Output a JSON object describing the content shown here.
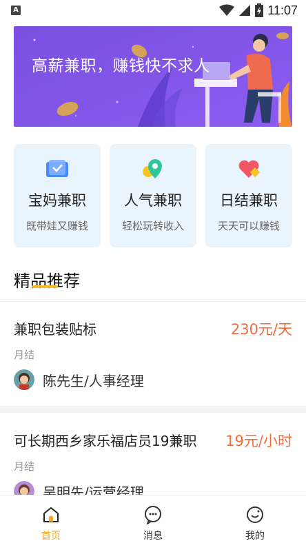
{
  "status_bar": {
    "left_badge": "A",
    "time": "11:07",
    "icons": [
      "wifi-icon",
      "signal-icon",
      "battery-icon"
    ]
  },
  "banner": {
    "title": "高薪兼职，赚钱快不求人"
  },
  "categories": [
    {
      "title": "宝妈兼职",
      "subtitle": "既带娃又赚钱",
      "icon": "card-icon"
    },
    {
      "title": "人气兼职",
      "subtitle": "轻松玩转收入",
      "icon": "location-icon"
    },
    {
      "title": "日结兼职",
      "subtitle": "天天可以赚钱",
      "icon": "heart-icon"
    }
  ],
  "section": {
    "title": "精品推荐"
  },
  "jobs": [
    {
      "title": "兼职包装贴标",
      "salary": "230元/天",
      "pay_cycle": "月结",
      "poster": "陈先生/人事经理"
    },
    {
      "title": "可长期西乡家乐福店员19兼职",
      "salary": "19元/小时",
      "pay_cycle": "月结",
      "poster": "吴明先/运营经理"
    }
  ],
  "bottom_nav": [
    {
      "label": "首页",
      "active": true
    },
    {
      "label": "消息",
      "active": false
    },
    {
      "label": "我的",
      "active": false
    }
  ],
  "colors": {
    "accent": "#f5a623",
    "salary": "#f26b3a",
    "card_bg": "#eaf4fd"
  }
}
